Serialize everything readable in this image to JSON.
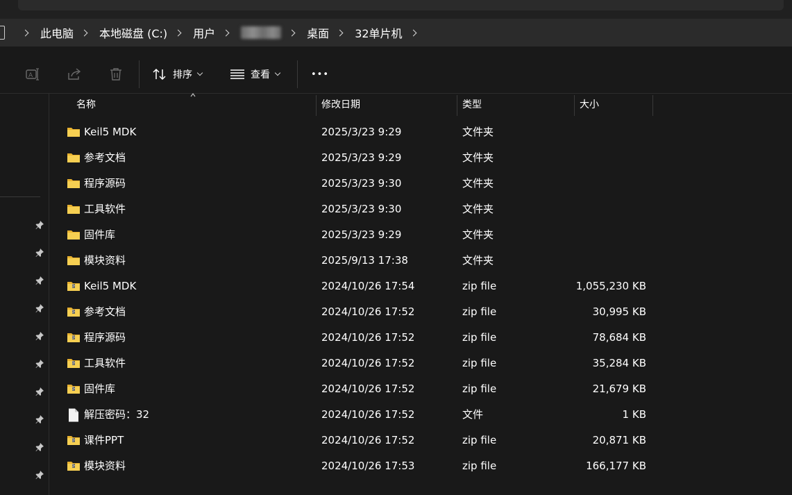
{
  "breadcrumb": [
    "此电脑",
    "本地磁盘 (C:)",
    "用户",
    "",
    "桌面",
    "32单片机"
  ],
  "toolbar": {
    "sort_label": "排序",
    "view_label": "查看",
    "more_label": "•••"
  },
  "columns": {
    "name": "名称",
    "modified": "修改日期",
    "type": "类型",
    "size": "大小"
  },
  "files": [
    {
      "icon": "folder-icon",
      "name": "Keil5 MDK",
      "modified": "2025/3/23 9:29",
      "type": "文件夹",
      "size": ""
    },
    {
      "icon": "folder-icon",
      "name": "参考文档",
      "modified": "2025/3/23 9:29",
      "type": "文件夹",
      "size": ""
    },
    {
      "icon": "folder-icon",
      "name": "程序源码",
      "modified": "2025/3/23 9:30",
      "type": "文件夹",
      "size": ""
    },
    {
      "icon": "folder-icon",
      "name": "工具软件",
      "modified": "2025/3/23 9:30",
      "type": "文件夹",
      "size": ""
    },
    {
      "icon": "folder-icon",
      "name": "固件库",
      "modified": "2025/3/23 9:29",
      "type": "文件夹",
      "size": ""
    },
    {
      "icon": "folder-icon",
      "name": "模块资料",
      "modified": "2025/9/13 17:38",
      "type": "文件夹",
      "size": ""
    },
    {
      "icon": "zip-folder-icon",
      "name": "Keil5 MDK",
      "modified": "2024/10/26 17:54",
      "type": "zip file",
      "size": "1,055,230 KB"
    },
    {
      "icon": "zip-folder-icon",
      "name": "参考文档",
      "modified": "2024/10/26 17:52",
      "type": "zip file",
      "size": "30,995 KB"
    },
    {
      "icon": "zip-folder-icon",
      "name": "程序源码",
      "modified": "2024/10/26 17:52",
      "type": "zip file",
      "size": "78,684 KB"
    },
    {
      "icon": "zip-folder-icon",
      "name": "工具软件",
      "modified": "2024/10/26 17:52",
      "type": "zip file",
      "size": "35,284 KB"
    },
    {
      "icon": "zip-folder-icon",
      "name": "固件库",
      "modified": "2024/10/26 17:52",
      "type": "zip file",
      "size": "21,679 KB"
    },
    {
      "icon": "document-icon",
      "name": "解压密码：32",
      "modified": "2024/10/26 17:52",
      "type": "文件",
      "size": "1 KB"
    },
    {
      "icon": "zip-folder-icon",
      "name": "课件PPT",
      "modified": "2024/10/26 17:52",
      "type": "zip file",
      "size": "20,871 KB"
    },
    {
      "icon": "zip-folder-icon",
      "name": "模块资料",
      "modified": "2024/10/26 17:53",
      "type": "zip file",
      "size": "166,177 KB"
    }
  ],
  "colors": {
    "background": "#191919",
    "address_bar": "#2b2b2b",
    "folder_yellow": "#f4c542",
    "text": "#ffffff"
  }
}
